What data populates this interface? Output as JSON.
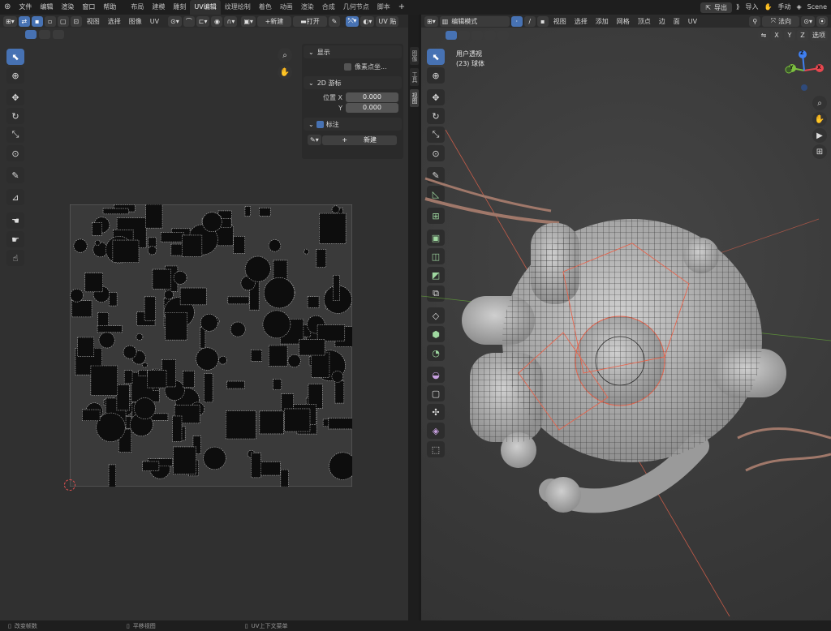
{
  "topbar": {
    "menus": [
      "文件",
      "编辑",
      "渲染",
      "窗口",
      "帮助"
    ],
    "workspaces": [
      "布局",
      "建模",
      "雕刻",
      "UV编辑",
      "纹理绘制",
      "着色",
      "动画",
      "渲染",
      "合成",
      "几何节点",
      "脚本"
    ],
    "active_workspace": "UV编辑",
    "add_tab": "+",
    "export_label": "导出",
    "import_label": "导入",
    "manual_label": "手动",
    "scene_label": "Scene"
  },
  "uv_editor": {
    "menus": [
      "视图",
      "选择",
      "图像",
      "UV"
    ],
    "new_label": "新建",
    "open_label": "打开",
    "uv_label": "UV 贴",
    "sidebar": {
      "display_header": "显示",
      "pixel_coords": "像素点坐...",
      "cursor_header": "2D 游标",
      "pos_x_label": "位置 X",
      "pos_x_value": "0.000",
      "pos_y_label": "Y",
      "pos_y_value": "0.000",
      "annotation_header": "标注",
      "annotation_new": "新建"
    },
    "vtabs": [
      "图像",
      "工具",
      "视图"
    ]
  },
  "viewport": {
    "mode_label": "编辑模式",
    "menus": [
      "视图",
      "选择",
      "添加",
      "网格",
      "顶点",
      "边",
      "面",
      "UV"
    ],
    "orientation_label": "法向",
    "axes_x": "X",
    "axes_y": "Y",
    "axes_z": "Z",
    "options_label": "选项",
    "view_name": "用户透视",
    "object_name": "(23) 球体",
    "gizmo": {
      "x": "X",
      "y": "Y",
      "z": "Z"
    }
  },
  "status": {
    "item1": "改变帧数",
    "item2": "平移视图",
    "item3": "UV上下文菜单"
  },
  "colors": {
    "accent": "#4772b3",
    "bg_editor": "#303030",
    "wire_red": "#e8644c",
    "gizmo_x": "#e8474f",
    "gizmo_y": "#7cbf3f",
    "gizmo_z": "#3f7ff0"
  }
}
